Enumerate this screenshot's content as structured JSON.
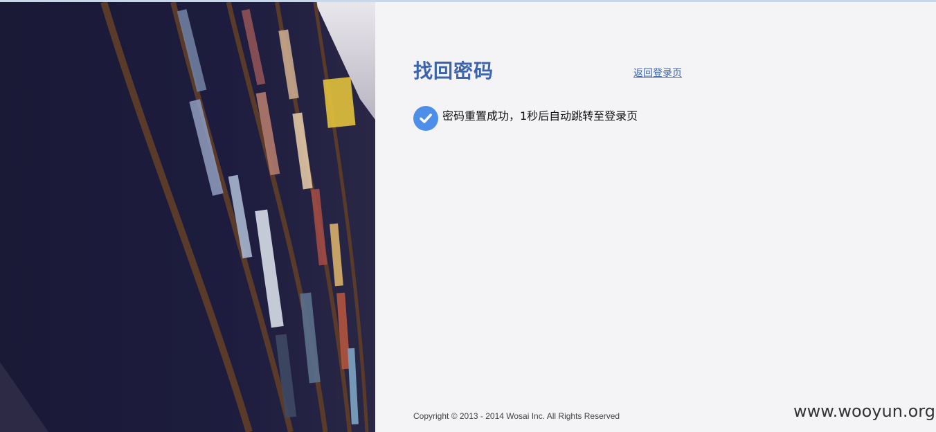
{
  "page": {
    "title": "找回密码",
    "back_link": "返回登录页"
  },
  "status": {
    "icon": "check-circle-icon",
    "message": "密码重置成功，1秒后自动跳转至登录页"
  },
  "footer": {
    "copyright": "Copyright © 2013 - 2014 Wosai Inc. All Rights Reserved",
    "watermark": "www.wooyun.org"
  },
  "colors": {
    "accent": "#3b64ad",
    "check": "#4d8ee8",
    "background": "#f4f4f7",
    "image_dark": "#1b1a3a"
  }
}
